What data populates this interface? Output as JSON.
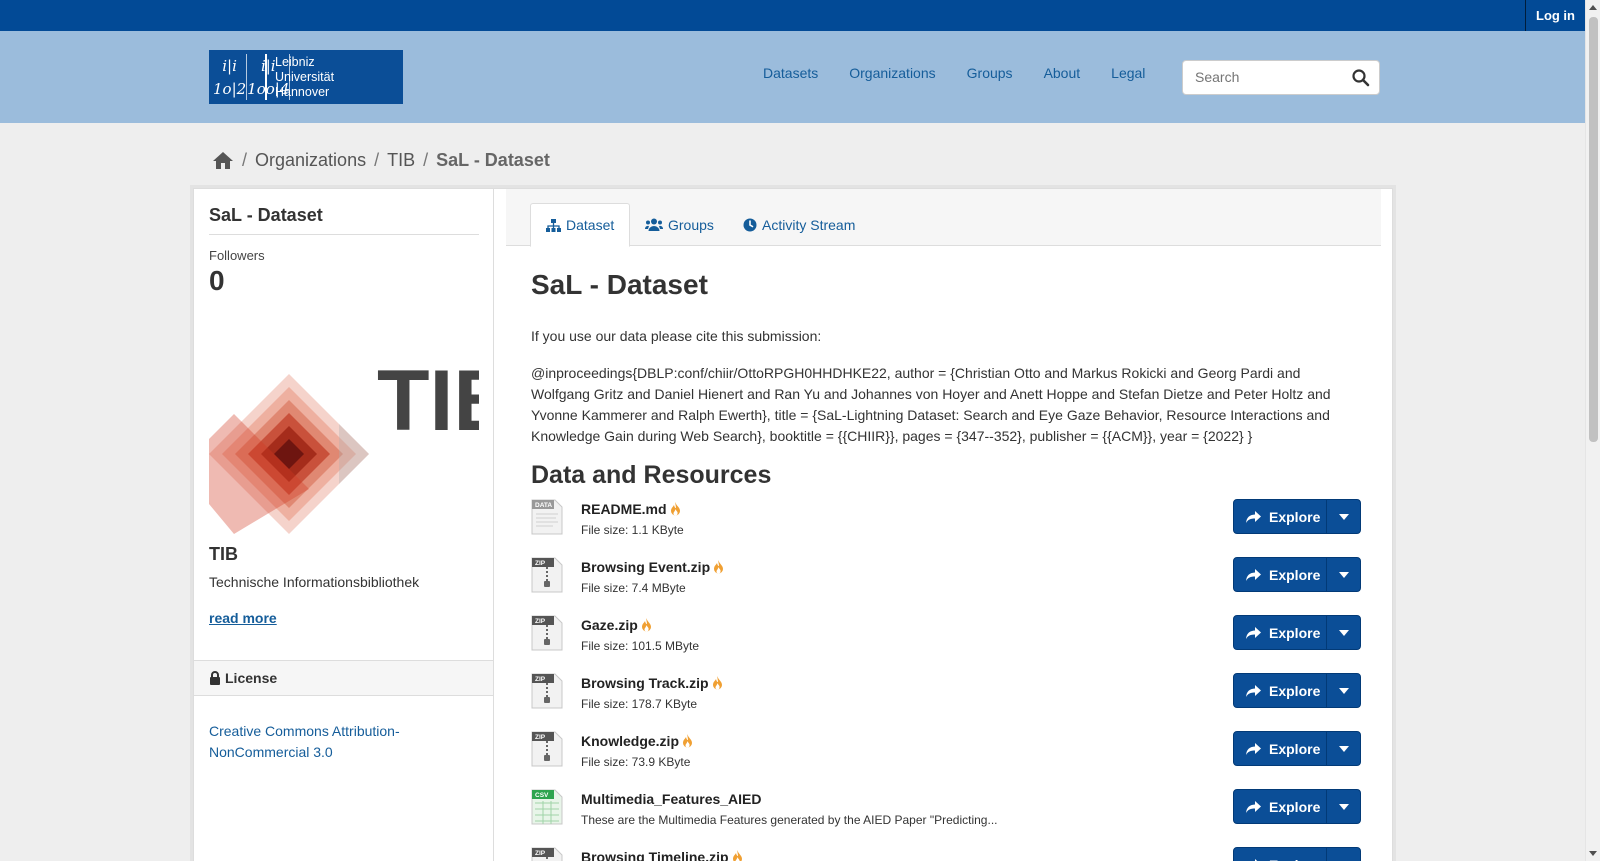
{
  "topbar": {
    "login": "Log in"
  },
  "logo": {
    "mark": [
      "i|i",
      "i|i",
      "1o|2",
      "1oo|4"
    ],
    "line1": "Leibniz",
    "line2": "Universität",
    "line3": "Hannover"
  },
  "nav": {
    "items": [
      "Datasets",
      "Organizations",
      "Groups",
      "About",
      "Legal"
    ]
  },
  "search": {
    "placeholder": "Search"
  },
  "breadcrumb": {
    "items": [
      "Organizations",
      "TIB"
    ],
    "active": "SaL - Dataset"
  },
  "sidebar": {
    "title": "SaL - Dataset",
    "followers_label": "Followers",
    "followers_count": "0",
    "logo_text": "TIB",
    "org_name": "TIB",
    "org_desc": "Technische Informationsbibliothek",
    "read_more": "read more",
    "license_heading": "License",
    "license_link": "Creative Commons Attribution-NonCommercial 3.0"
  },
  "tabs": [
    {
      "label": "Dataset",
      "icon": "sitemap-icon"
    },
    {
      "label": "Groups",
      "icon": "users-icon"
    },
    {
      "label": "Activity Stream",
      "icon": "clock-icon"
    }
  ],
  "main": {
    "title": "SaL - Dataset",
    "cite_intro": "If you use our data please cite this submission:",
    "cite_text": "@inproceedings{DBLP:conf/chiir/OttoRPGH0HHDHKE22, author = {Christian Otto and Markus Rokicki and Georg Pardi and Wolfgang Gritz and Daniel Hienert and Ran Yu and Johannes von Hoyer and Anett Hoppe and Stefan Dietze and Peter Holtz and Yvonne Kammerer and Ralph Ewerth}, title = {SaL-Lightning Dataset: Search and Eye Gaze Behavior, Resource Interactions and Knowledge Gain during Web Search}, booktitle = {{CHIIR}}, pages = {347--352}, publisher = {{ACM}}, year = {2022} }",
    "resources_heading": "Data and Resources"
  },
  "resources": [
    {
      "name": "README.md",
      "size": "File size: 1.1 KByte",
      "type": "DATA",
      "explore": "Explore"
    },
    {
      "name": "Browsing Event.zip",
      "size": "File size: 7.4 MByte",
      "type": "ZIP",
      "explore": "Explore"
    },
    {
      "name": "Gaze.zip",
      "size": "File size: 101.5 MByte",
      "type": "ZIP",
      "explore": "Explore"
    },
    {
      "name": "Browsing Track.zip",
      "size": "File size: 178.7 KByte",
      "type": "ZIP",
      "explore": "Explore"
    },
    {
      "name": "Knowledge.zip",
      "size": "File size: 73.9 KByte",
      "type": "ZIP",
      "explore": "Explore"
    },
    {
      "name": "Multimedia_Features_AIED",
      "size": "These are the Multimedia Features generated by the AIED Paper \"Predicting...",
      "type": "CSV",
      "explore": "Explore"
    },
    {
      "name": "Browsing Timeline.zip",
      "size": "",
      "type": "ZIP",
      "explore": "Explore"
    }
  ],
  "colors": {
    "topbar": "#024a96",
    "masthead": "#9bbcdc",
    "link": "#155d9a",
    "button": "#0b4e97",
    "flame": "#f0a033"
  }
}
